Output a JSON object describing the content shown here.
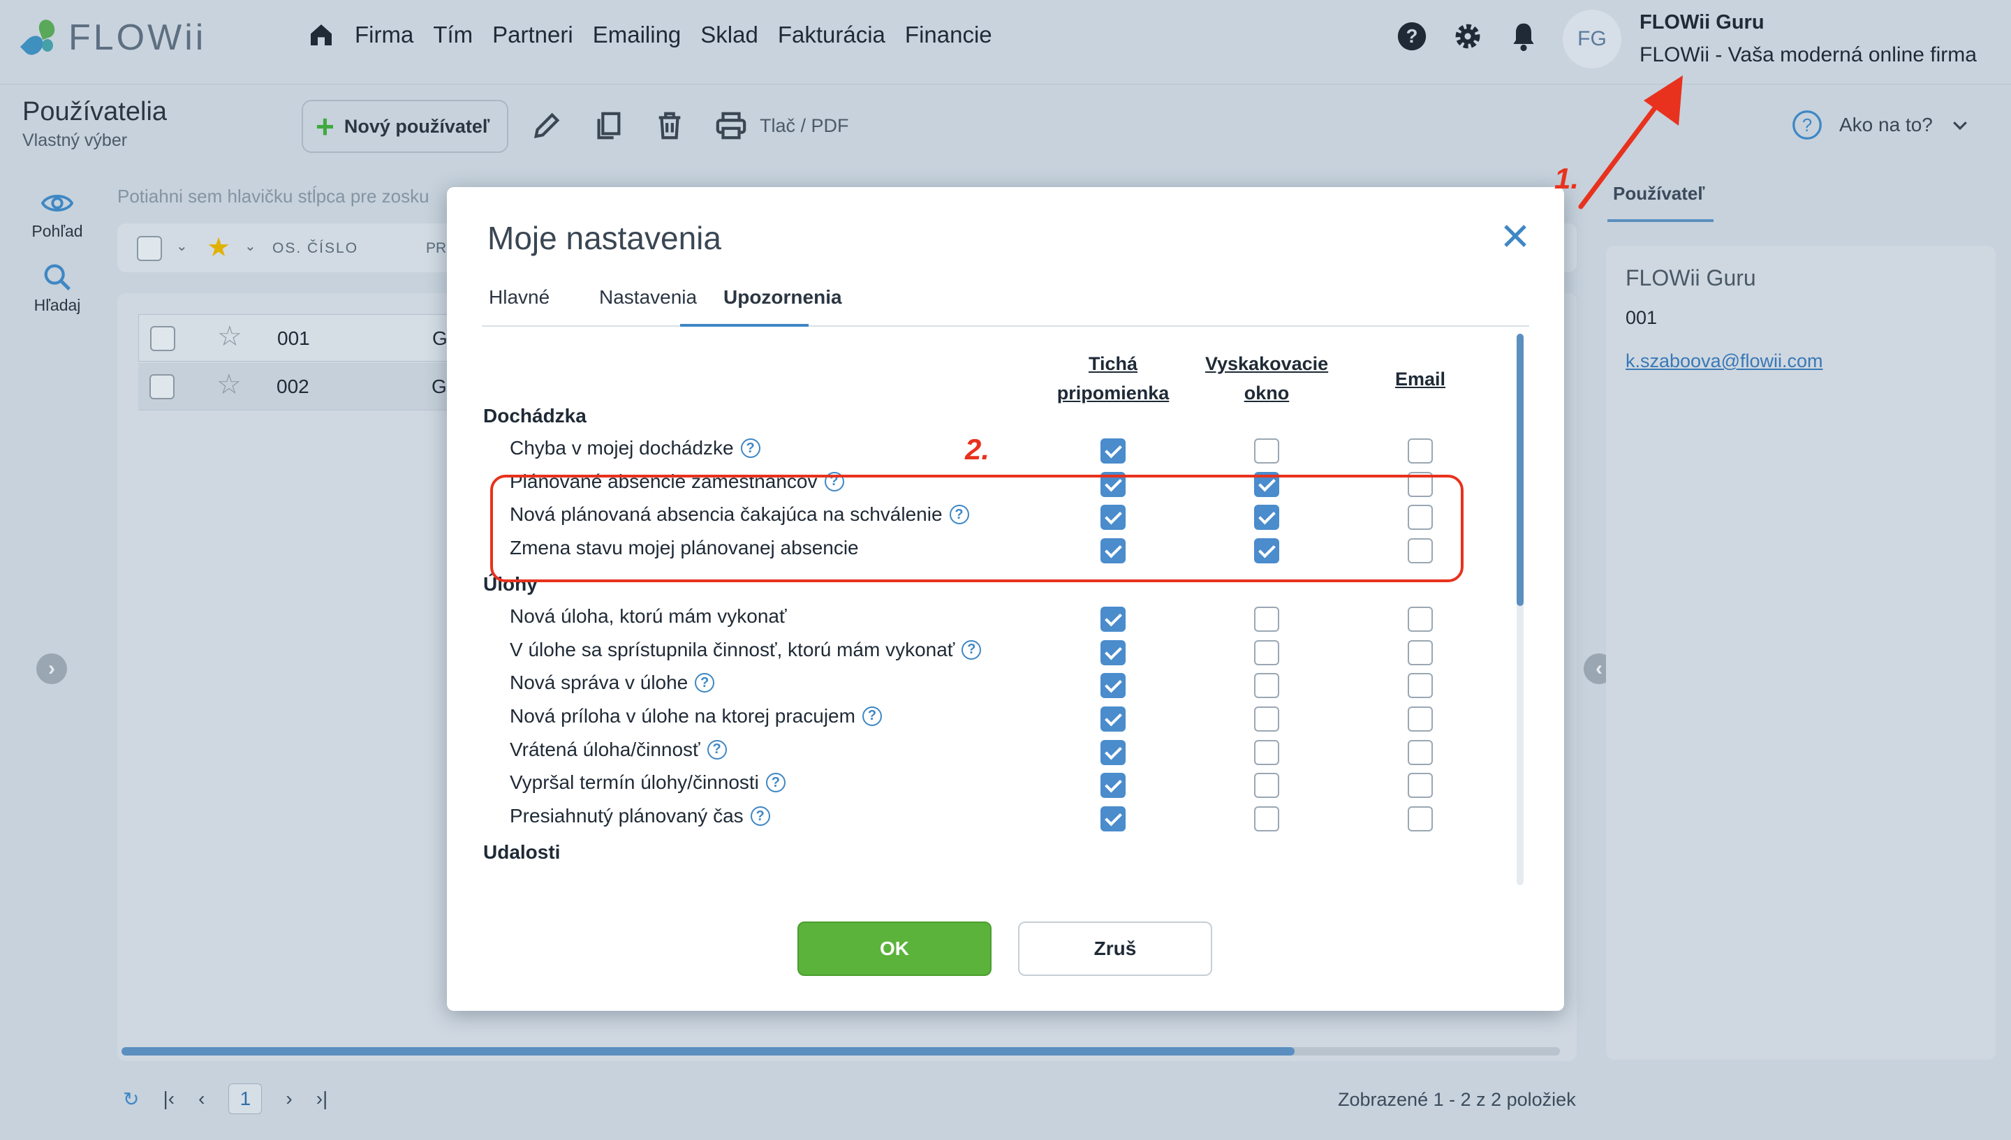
{
  "header": {
    "logo_text": "FLOWii",
    "nav": [
      "Firma",
      "Tím",
      "Partneri",
      "Emailing",
      "Sklad",
      "Fakturácia",
      "Financie"
    ],
    "avatar_initials": "FG",
    "user_name": "FLOWii Guru",
    "user_company": "FLOWii - Vaša moderná online firma"
  },
  "toolbar": {
    "title": "Používatelia",
    "subtitle": "Vlastný výber",
    "new_user": "Nový používateľ",
    "print": "Tlač / PDF",
    "help": "Ako na to?"
  },
  "rail": {
    "view": "Pohľad",
    "search": "Hľadaj"
  },
  "grid": {
    "group_hint": "Potiahni sem hlavičku stĺpca pre zosku",
    "col_id": "OS. ČÍSLO",
    "col_name": "PR",
    "rows": [
      {
        "id": "001",
        "name": "Gu"
      },
      {
        "id": "002",
        "name": "Gu"
      }
    ],
    "page": "1",
    "pager_info": "Zobrazené 1 - 2 z 2 položiek"
  },
  "right_panel": {
    "tab": "Používateľ",
    "name": "FLOWii Guru",
    "id": "001",
    "email": "k.szaboova@flowii.com"
  },
  "annotations": {
    "one": "1.",
    "two": "2."
  },
  "colors": {
    "accent": "#3f87c4",
    "ok": "#5bb33b",
    "annotation": "#e8321e"
  },
  "modal": {
    "title": "Moje nastavenia",
    "tabs": [
      "Hlavné",
      "Nastavenia",
      "Upozornenia"
    ],
    "active_tab": "Upozornenia",
    "columns": {
      "silent": [
        "Tichá",
        "pripomienka"
      ],
      "popup": [
        "Vyskakovacie",
        "okno"
      ],
      "email": "Email"
    },
    "sections": [
      {
        "name": "Dochádzka",
        "items": [
          {
            "label": "Chyba v mojej dochádzke",
            "help": true,
            "silent": true,
            "popup": false,
            "email": false
          },
          {
            "label": "Plánované absencie zamestnancov",
            "help": true,
            "silent": true,
            "popup": true,
            "email": false
          },
          {
            "label": "Nová plánovaná absencia čakajúca na schválenie",
            "help": true,
            "silent": true,
            "popup": true,
            "email": false
          },
          {
            "label": "Zmena stavu mojej plánovanej absencie",
            "help": false,
            "silent": true,
            "popup": true,
            "email": false
          }
        ]
      },
      {
        "name": "Úlohy",
        "items": [
          {
            "label": "Nová úloha, ktorú mám vykonať",
            "help": false,
            "silent": true,
            "popup": false,
            "email": false
          },
          {
            "label": "V úlohe sa sprístupnila činnosť, ktorú mám vykonať",
            "help": true,
            "silent": true,
            "popup": false,
            "email": false
          },
          {
            "label": "Nová správa v úlohe",
            "help": true,
            "silent": true,
            "popup": false,
            "email": false
          },
          {
            "label": "Nová príloha v úlohe na ktorej pracujem",
            "help": true,
            "silent": true,
            "popup": false,
            "email": false
          },
          {
            "label": "Vrátená úloha/činnosť",
            "help": true,
            "silent": true,
            "popup": false,
            "email": false
          },
          {
            "label": "Vypršal termín úlohy/činnosti",
            "help": true,
            "silent": true,
            "popup": false,
            "email": false
          },
          {
            "label": "Presiahnutý plánovaný čas",
            "help": true,
            "silent": true,
            "popup": false,
            "email": false
          }
        ]
      },
      {
        "name": "Udalosti",
        "items": []
      }
    ],
    "ok": "OK",
    "cancel": "Zruš"
  }
}
